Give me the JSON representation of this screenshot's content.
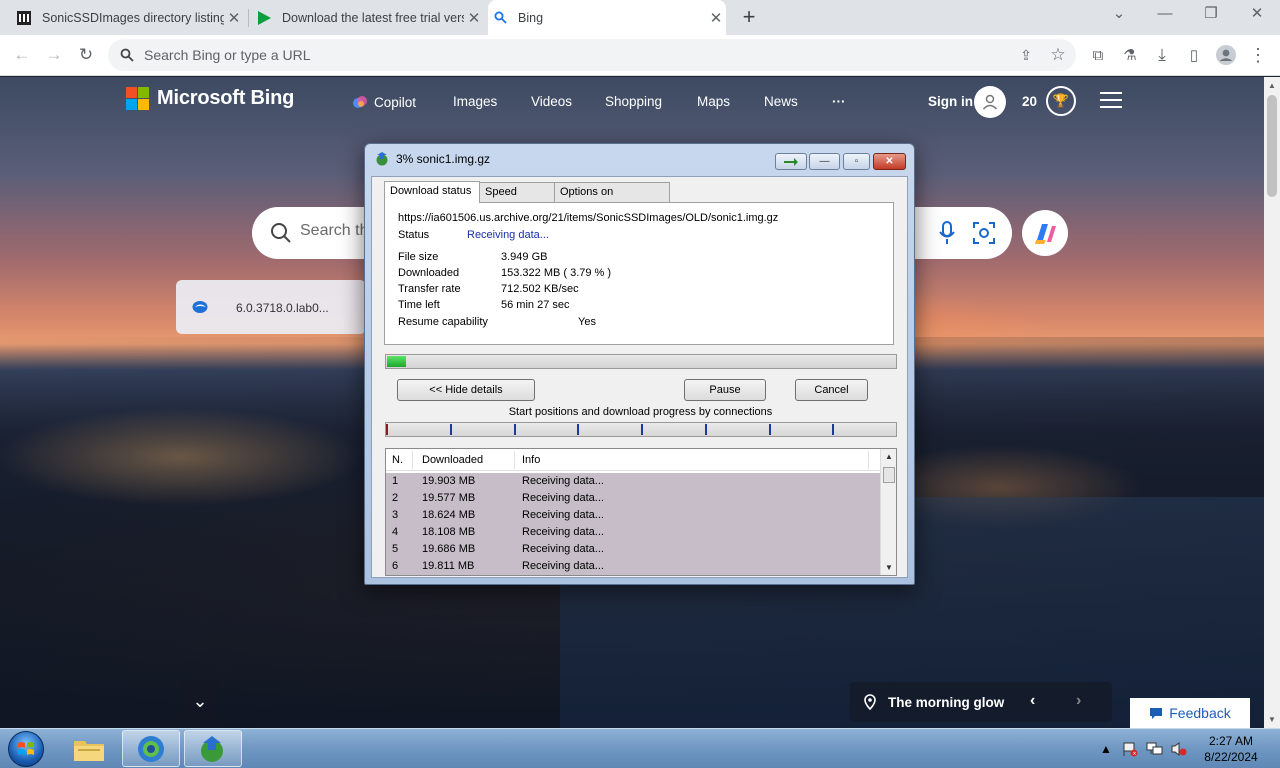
{
  "browser": {
    "tabs": [
      {
        "title": "SonicSSDImages directory listing",
        "close": "✕"
      },
      {
        "title": "Download the latest free trial version",
        "close": "✕"
      },
      {
        "title": "Bing",
        "close": "✕"
      }
    ],
    "new_tab": "+",
    "omnibox_placeholder": "Search Bing or type a URL"
  },
  "bing": {
    "brand": "Microsoft Bing",
    "nav": [
      "Copilot",
      "Images",
      "Videos",
      "Shopping",
      "Maps",
      "News",
      "···"
    ],
    "sign_in": "Sign in",
    "rewards": "20",
    "search_placeholder": "Search the web",
    "tile_text": "6.0.3718.0.lab0...",
    "image_caption": "The morning glow",
    "feedback": "Feedback",
    "colors": {
      "ms_red": "#f25022",
      "ms_green": "#7fba00",
      "ms_blue": "#00a4ef",
      "ms_yellow": "#ffb900"
    }
  },
  "idm": {
    "title": "3% sonic1.img.gz",
    "tabs": [
      "Download status",
      "Speed Limiter",
      "Options on completion"
    ],
    "url": "https://ia601506.us.archive.org/21/items/SonicSSDImages/OLD/sonic1.img.gz",
    "status_label": "Status",
    "status_value": "Receiving data...",
    "fields": [
      {
        "label": "File size",
        "value": "3.949  GB"
      },
      {
        "label": "Downloaded",
        "value": "153.322  MB  ( 3.79 % )"
      },
      {
        "label": "Transfer rate",
        "value": "712.502  KB/sec"
      },
      {
        "label": "Time left",
        "value": "56 min 27 sec"
      }
    ],
    "resume_label": "Resume capability",
    "resume_value": "Yes",
    "progress_fraction": 0.0379,
    "buttons": {
      "hide_details": "<< Hide details",
      "pause": "Pause",
      "cancel": "Cancel"
    },
    "connections_label": "Start positions and download progress by connections",
    "connection_count": 8,
    "list_headers": {
      "n": "N.",
      "downloaded": "Downloaded",
      "info": "Info"
    },
    "connections": [
      {
        "n": "1",
        "downloaded": "19.903  MB",
        "info": "Receiving data..."
      },
      {
        "n": "2",
        "downloaded": "19.577  MB",
        "info": "Receiving data..."
      },
      {
        "n": "3",
        "downloaded": "18.624  MB",
        "info": "Receiving data..."
      },
      {
        "n": "4",
        "downloaded": "18.108  MB",
        "info": "Receiving data..."
      },
      {
        "n": "5",
        "downloaded": "19.686  MB",
        "info": "Receiving data..."
      },
      {
        "n": "6",
        "downloaded": "19.811  MB",
        "info": "Receiving data..."
      }
    ]
  },
  "taskbar": {
    "time": "2:27 AM",
    "date": "8/22/2024"
  }
}
